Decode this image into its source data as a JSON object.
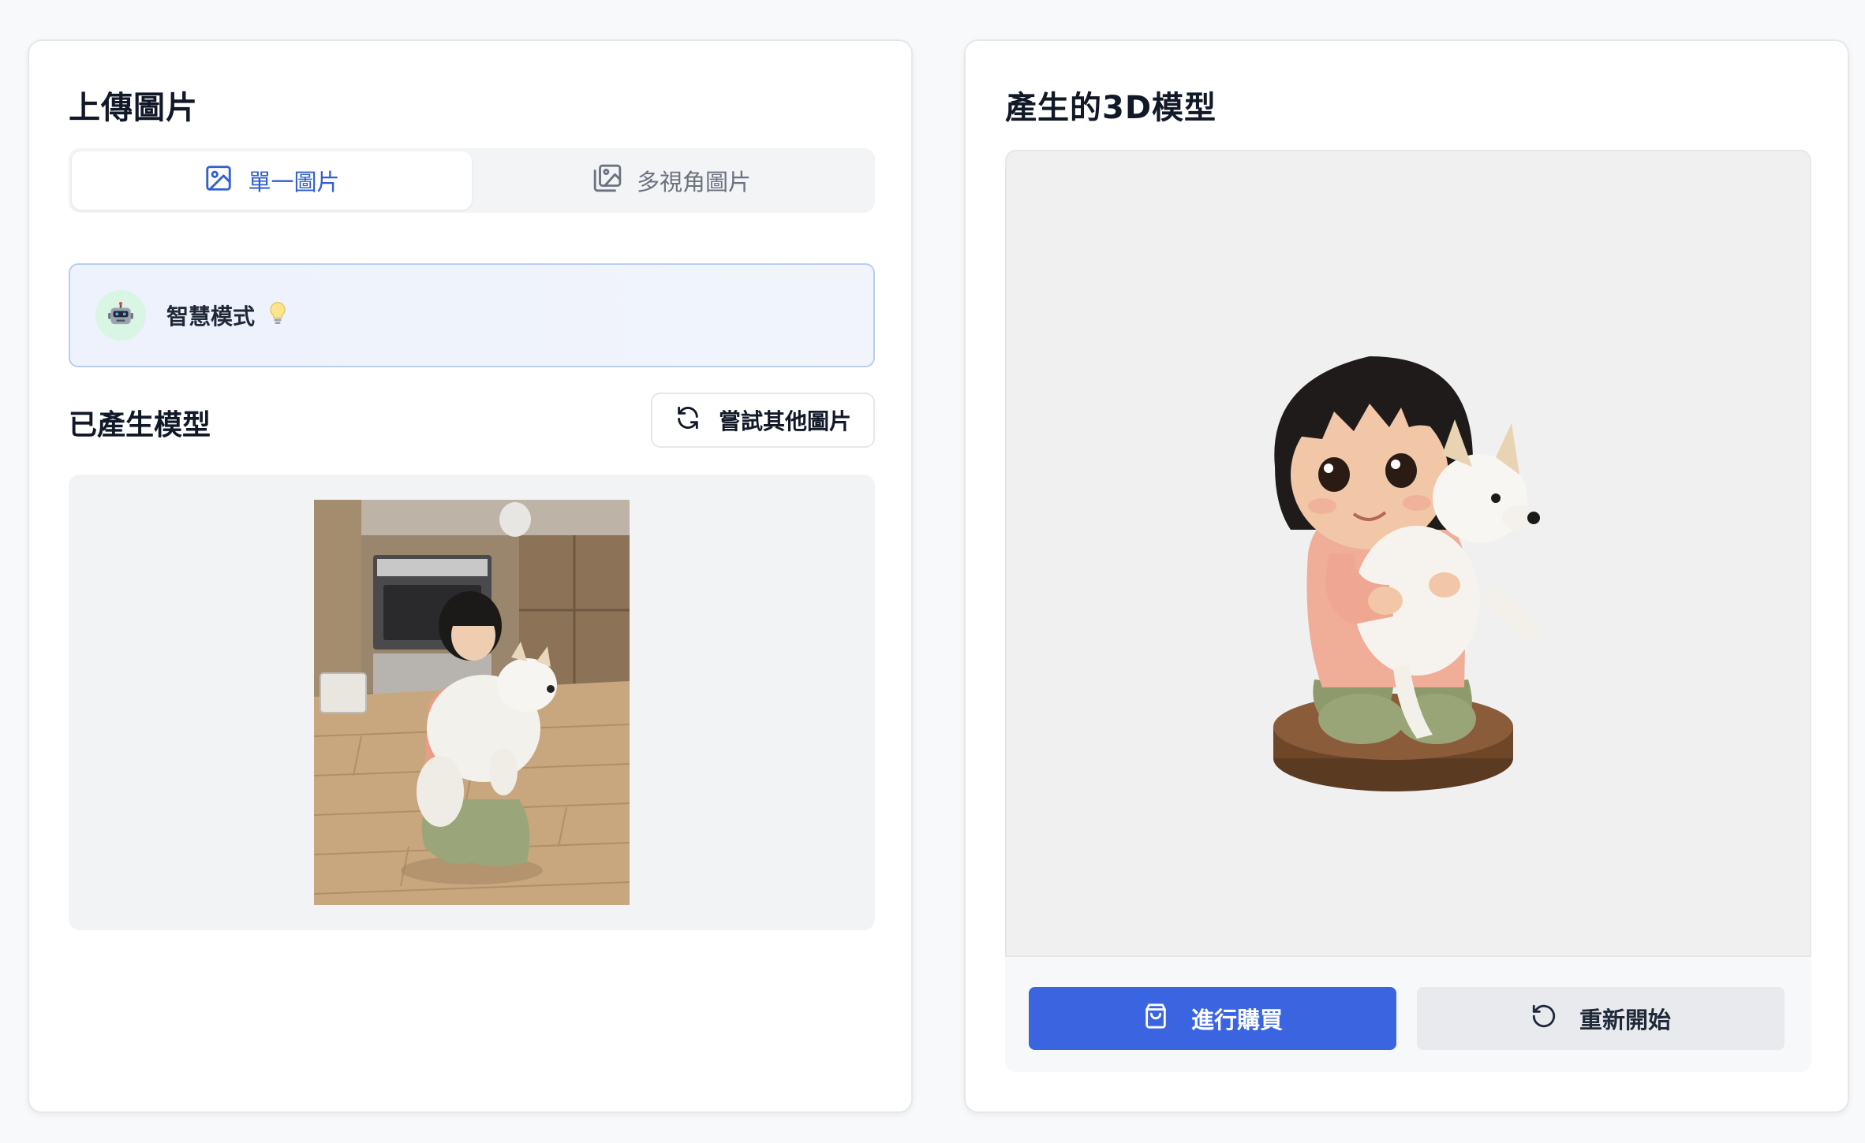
{
  "upload_card": {
    "title": "上傳圖片",
    "tabs": [
      {
        "label": "單一圖片",
        "icon": "image-icon",
        "active": true
      },
      {
        "label": "多視角圖片",
        "icon": "images-icon",
        "active": false
      }
    ],
    "smart_mode": {
      "label": "智慧模式",
      "icon": "robot-icon",
      "hint_icon": "lightbulb-icon"
    },
    "generated_section": {
      "title": "已產生模型",
      "try_other_button": "嘗試其他圖片"
    }
  },
  "model_card": {
    "title": "產生的3D模型",
    "buy_button": "進行購買",
    "restart_button": "重新開始"
  },
  "colors": {
    "accent": "#3a64e0",
    "tab_active_text": "#2f5fd0",
    "smart_border": "#b9cdef"
  }
}
